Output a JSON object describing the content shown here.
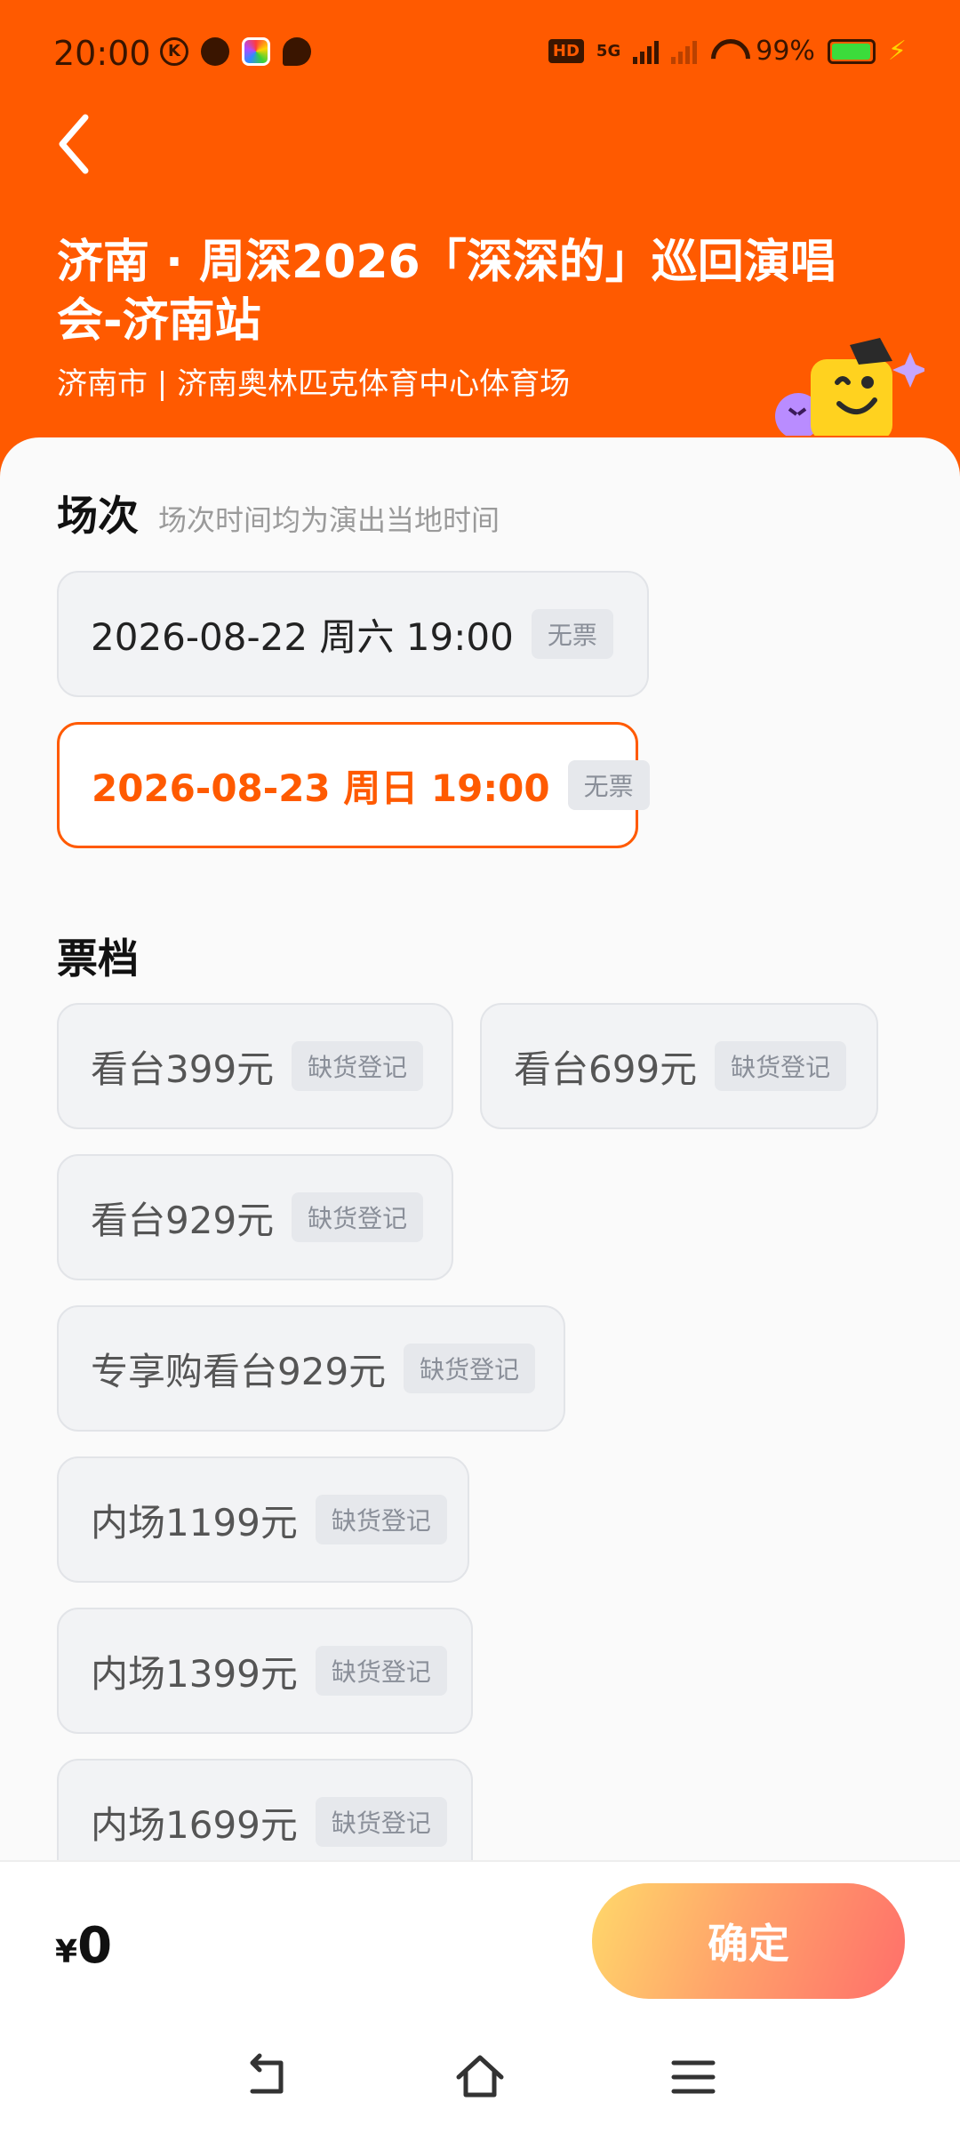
{
  "status_bar": {
    "time": "20:00",
    "network": "5G",
    "hd_label": "HD",
    "battery": "99%"
  },
  "header": {
    "title": "济南 · 周深2026「深深的」巡回演唱会-济南站",
    "venue": "济南市 | 济南奥林匹克体育中心体育场"
  },
  "sessions_section": {
    "title": "场次",
    "hint": "场次时间均为演出当地时间",
    "items": [
      {
        "label": "2026-08-22  周六 19:00",
        "badge": "无票",
        "selected": false
      },
      {
        "label": "2026-08-23 周日 19:00",
        "badge": "无票",
        "selected": true
      }
    ]
  },
  "tiers_section": {
    "title": "票档",
    "items": [
      {
        "label": "看台399元",
        "badge": "缺货登记"
      },
      {
        "label": "看台699元",
        "badge": "缺货登记"
      },
      {
        "label": "看台929元",
        "badge": "缺货登记"
      },
      {
        "label": "专享购看台929元",
        "badge": "缺货登记"
      },
      {
        "label": "内场1199元",
        "badge": "缺货登记"
      },
      {
        "label": "内场1399元",
        "badge": "缺货登记"
      },
      {
        "label": "内场1699元",
        "badge": "缺货登记"
      }
    ]
  },
  "footer": {
    "currency": "¥",
    "total": "0",
    "confirm_label": "确定"
  },
  "colors": {
    "brand": "#ff5a00",
    "sheet_bg": "#fafafa",
    "badge_text": "#8a8f99"
  }
}
